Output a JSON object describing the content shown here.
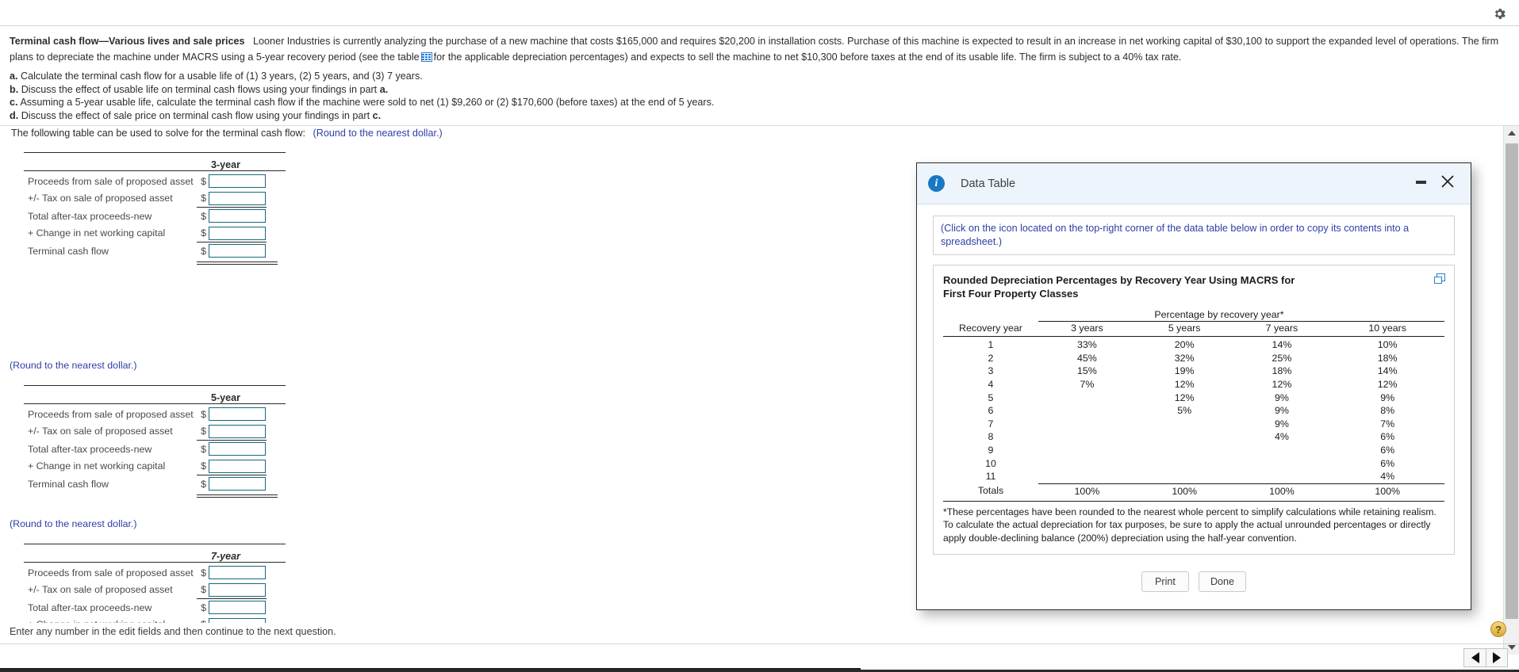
{
  "topbar": {
    "gear_icon": "gear-icon"
  },
  "question": {
    "title": "Terminal cash flow—Various lives and sale prices",
    "body_part1": "Looner Industries is currently analyzing the purchase of a new machine that costs $165,000 and requires $20,200 in installation costs. Purchase of this machine is expected to result in an increase in net working capital of $30,100 to support the expanded level of operations. The firm plans to depreciate the machine under MACRS using a 5-year recovery period (see the table",
    "body_part2": "for the applicable depreciation percentages) and expects to sell the machine to net $10,300 before taxes at the end of its usable life. The firm is subject to a 40% tax rate.",
    "table_icon": "data-table-icon",
    "parts": [
      {
        "letter": "a.",
        "text": "Calculate the terminal cash flow for a usable life of  (1) 3 years, (2) 5 years, and (3) 7 years."
      },
      {
        "letter": "b.",
        "text": "Discuss the effect of usable life on terminal cash flows using your findings in part ",
        "bold_tail": "a."
      },
      {
        "letter": "c.",
        "text": " Assuming a 5-year usable life, calculate the terminal cash flow if the machine were sold to net (1) $9,260 or (2) $170,600 (before taxes) at the end of 5 years.",
        "bold_tail": ""
      },
      {
        "letter": "d.",
        "text": "Discuss the effect of sale price on terminal cash flow using your findings in part ",
        "bold_tail": "c."
      }
    ]
  },
  "work": {
    "lead_text": "The following table can be used to solve for the terminal cash flow:",
    "lead_hint": "(Round to the nearest dollar.)",
    "round_note": "(Round to the nearest dollar.)",
    "row_labels": [
      "Proceeds from sale of proposed asset",
      "+/- Tax on sale of proposed asset",
      "Total after-tax proceeds-new",
      "+ Change in net working capital",
      "Terminal cash flow"
    ],
    "dollar_sign": "$",
    "tables": [
      {
        "header": "3-year",
        "italic": false,
        "values": [
          "",
          "",
          "",
          "",
          ""
        ]
      },
      {
        "header": "5-year",
        "italic": false,
        "values": [
          "",
          "",
          "",
          "",
          ""
        ]
      },
      {
        "header": "7-year",
        "italic": true,
        "values": [
          "",
          "",
          "",
          "",
          ""
        ]
      }
    ]
  },
  "footer": {
    "message": "Enter any number in the edit fields and then continue to the next question.",
    "help_label": "?",
    "prev_icon": "previous-arrow-icon",
    "next_icon": "next-arrow-icon"
  },
  "dialog": {
    "title": "Data Table",
    "info_icon": "info-icon",
    "minimize_icon": "minimize-icon",
    "close_icon": "close-icon",
    "copy_icon": "copy-to-spreadsheet-icon",
    "copy_note": "(Click on the icon located on the top-right corner of the data table below in order to copy its contents into a spreadsheet.)",
    "table_title": "Rounded Depreciation Percentages by Recovery Year Using MACRS for First Four Property Classes",
    "footnote": "*These percentages have been rounded to the nearest whole percent to simplify calculations while retaining realism. To calculate the actual depreciation for tax purposes, be sure to apply the actual unrounded percentages or directly apply double-declining balance (200%) depreciation using the half-year convention.",
    "buttons": {
      "print": "Print",
      "done": "Done"
    }
  },
  "chart_data": {
    "type": "table",
    "title": "Rounded Depreciation Percentages by Recovery Year Using MACRS for First Four Property Classes",
    "spanner": "Percentage by recovery year*",
    "row_header": "Recovery year",
    "categories": [
      "3 years",
      "5 years",
      "7 years",
      "10 years"
    ],
    "rows": [
      {
        "year": "1",
        "values": [
          "33%",
          "20%",
          "14%",
          "10%"
        ]
      },
      {
        "year": "2",
        "values": [
          "45%",
          "32%",
          "25%",
          "18%"
        ]
      },
      {
        "year": "3",
        "values": [
          "15%",
          "19%",
          "18%",
          "14%"
        ]
      },
      {
        "year": "4",
        "values": [
          "7%",
          "12%",
          "12%",
          "12%"
        ]
      },
      {
        "year": "5",
        "values": [
          "",
          "12%",
          "9%",
          "9%"
        ]
      },
      {
        "year": "6",
        "values": [
          "",
          "5%",
          "9%",
          "8%"
        ]
      },
      {
        "year": "7",
        "values": [
          "",
          "",
          "9%",
          "7%"
        ]
      },
      {
        "year": "8",
        "values": [
          "",
          "",
          "4%",
          "6%"
        ]
      },
      {
        "year": "9",
        "values": [
          "",
          "",
          "",
          "6%"
        ]
      },
      {
        "year": "10",
        "values": [
          "",
          "",
          "",
          "6%"
        ]
      },
      {
        "year": "11",
        "values": [
          "",
          "",
          "",
          "4%"
        ]
      }
    ],
    "totals_label": "Totals",
    "totals": [
      "100%",
      "100%",
      "100%",
      "100%"
    ]
  },
  "colors": {
    "accent_blue": "#2f7fd1",
    "hint_blue": "#2e3ea8",
    "field_border": "#16697a",
    "dialog_header": "#eef4fc"
  }
}
